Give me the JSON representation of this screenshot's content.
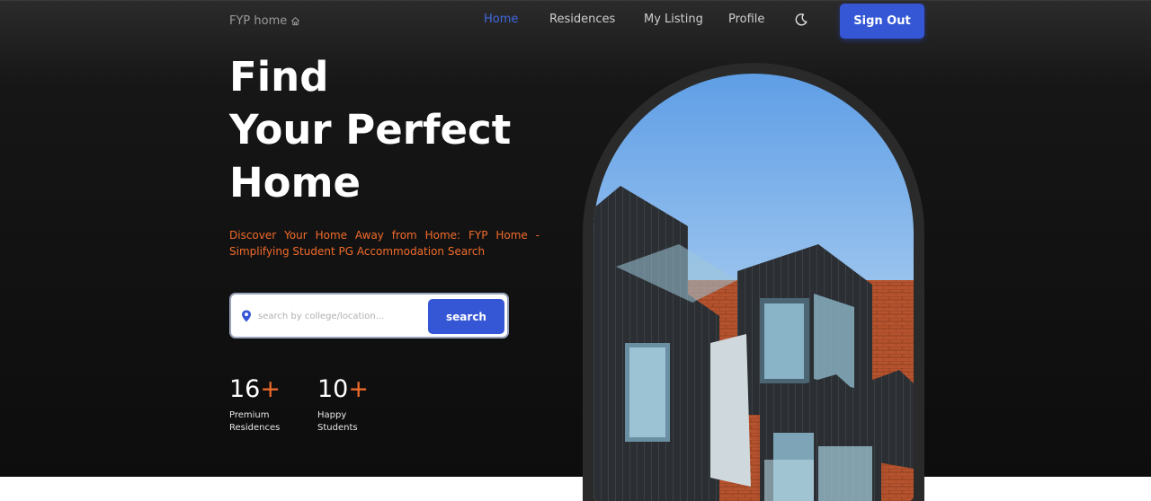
{
  "nav": {
    "logo_text": "FYP home",
    "logo_icon": "home-icon",
    "links": [
      {
        "label": "Home",
        "active": true
      },
      {
        "label": "Residences",
        "active": false
      },
      {
        "label": "My Listing",
        "active": false
      },
      {
        "label": "Profile",
        "active": false
      }
    ],
    "theme_icon": "moon-icon",
    "sign_out_label": "Sign Out"
  },
  "hero": {
    "headline": [
      "Find",
      "Your Perfect",
      "Home"
    ],
    "tagline": "Discover Your Home Away from Home: FYP Home - Simplifying Student PG Accommodation Search"
  },
  "search": {
    "icon": "location-pin-icon",
    "placeholder": "search by college/location...",
    "value": "",
    "button_label": "search"
  },
  "stats": [
    {
      "number": "16",
      "suffix": "+",
      "label": "Premium Residences"
    },
    {
      "number": "10",
      "suffix": "+",
      "label": "Happy Students"
    }
  ],
  "colors": {
    "accent": "#3557d6",
    "active_link": "#4169e1",
    "highlight": "#f26b2a",
    "background": "#0d0d0d"
  }
}
